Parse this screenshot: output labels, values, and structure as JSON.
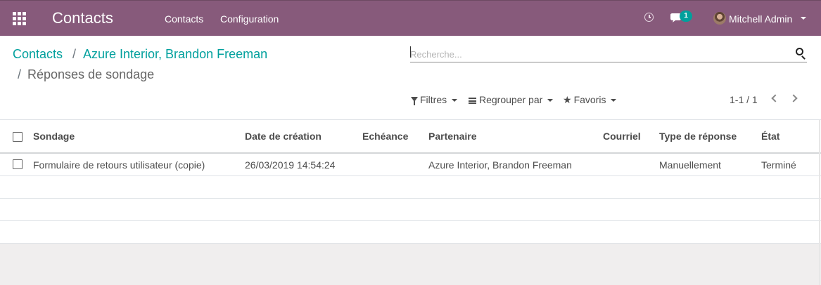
{
  "navbar": {
    "app_title": "Contacts",
    "menu": [
      "Contacts",
      "Configuration"
    ],
    "chat_count": "1",
    "user_name": "Mitchell Admin",
    "color": "#875a7b"
  },
  "breadcrumb": {
    "items": [
      "Contacts",
      "Azure Interior, Brandon Freeman"
    ],
    "separator": "/",
    "current": "Réponses de sondage"
  },
  "search": {
    "placeholder": "Recherche..."
  },
  "filters": {
    "filters_label": "Filtres",
    "group_label": "Regrouper par",
    "favorites_label": "Favoris"
  },
  "pager": {
    "value": "1-1 / 1"
  },
  "table": {
    "columns": [
      "Sondage",
      "Date de création",
      "Echéance",
      "Partenaire",
      "Courriel",
      "Type de réponse",
      "État"
    ],
    "rows": [
      {
        "sondage": "Formulaire de retours utilisateur (copie)",
        "date_creation": "26/03/2019 14:54:24",
        "echeance": "",
        "partenaire": "Azure Interior, Brandon Freeman",
        "courriel": "",
        "type_reponse": "Manuellement",
        "etat": "Terminé"
      }
    ]
  }
}
